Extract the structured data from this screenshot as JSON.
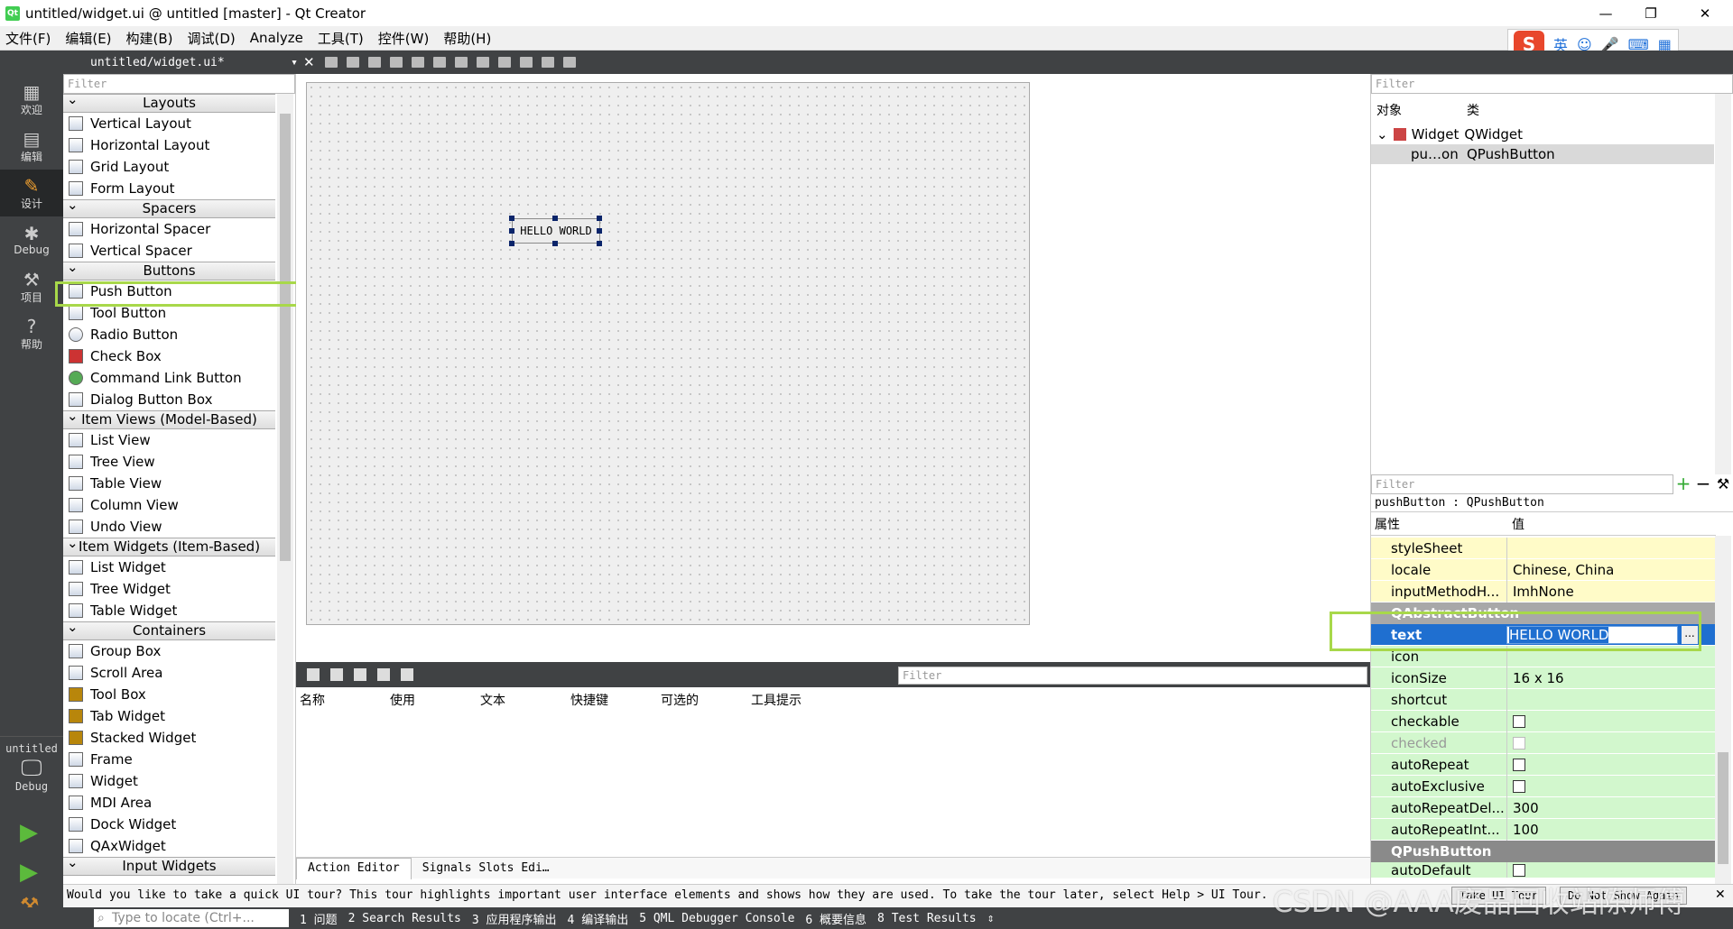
{
  "window": {
    "title": "untitled/widget.ui @ untitled [master] - Qt Creator",
    "app_icon": "Qt"
  },
  "menu": [
    "文件(F)",
    "编辑(E)",
    "构建(B)",
    "调试(D)",
    "Analyze",
    "工具(T)",
    "控件(W)",
    "帮助(H)"
  ],
  "ime": {
    "logo": "S",
    "lang": "英"
  },
  "modes": [
    {
      "label": "欢迎",
      "icon": "grid-icon"
    },
    {
      "label": "编辑",
      "icon": "edit-icon"
    },
    {
      "label": "设计",
      "icon": "design-icon",
      "active": true
    },
    {
      "label": "Debug",
      "icon": "bug-icon"
    },
    {
      "label": "项目",
      "icon": "wrench-icon"
    },
    {
      "label": "帮助",
      "icon": "help-icon"
    }
  ],
  "kit": {
    "project": "untitled",
    "mode": "Debug"
  },
  "document": {
    "tab": "untitled/widget.ui*"
  },
  "widgetbox": {
    "filter": "Filter",
    "layouts_title": "Layouts",
    "layouts": [
      "Vertical Layout",
      "Horizontal Layout",
      "Grid Layout",
      "Form Layout"
    ],
    "spacers_title": "Spacers",
    "spacers": [
      "Horizontal Spacer",
      "Vertical Spacer"
    ],
    "buttons_title": "Buttons",
    "buttons": [
      "Push Button",
      "Tool Button",
      "Radio Button",
      "Check Box",
      "Command Link Button",
      "Dialog Button Box"
    ],
    "itemviews_title": "Item Views (Model-Based)",
    "itemviews": [
      "List View",
      "Tree View",
      "Table View",
      "Column View",
      "Undo View"
    ],
    "itemwidgets_title": "Item Widgets (Item-Based)",
    "itemwidgets": [
      "List Widget",
      "Tree Widget",
      "Table Widget"
    ],
    "containers_title": "Containers",
    "containers": [
      "Group Box",
      "Scroll Area",
      "Tool Box",
      "Tab Widget",
      "Stacked Widget",
      "Frame",
      "Widget",
      "MDI Area",
      "Dock Widget",
      "QAxWidget"
    ],
    "input_title": "Input Widgets"
  },
  "form": {
    "button_text": "HELLO WORLD"
  },
  "action_editor": {
    "filter": "Filter",
    "columns": [
      "名称",
      "使用",
      "文本",
      "快捷键",
      "可选的",
      "工具提示"
    ],
    "tabs": [
      "Action Editor",
      "Signals Slots Edi…"
    ]
  },
  "object_inspector": {
    "filter": "Filter",
    "col_object": "对象",
    "col_class": "类",
    "rows": [
      {
        "object": "Widget",
        "class": "QWidget"
      },
      {
        "object": "pu…on",
        "class": "QPushButton"
      }
    ]
  },
  "property_editor": {
    "filter": "Filter",
    "header": "pushButton : QPushButton",
    "col_prop": "属性",
    "col_value": "值",
    "rows_top": [
      {
        "k": "styleSheet",
        "v": ""
      },
      {
        "k": "locale",
        "v": "Chinese, China"
      },
      {
        "k": "inputMethodH...",
        "v": "ImhNone"
      }
    ],
    "section_abstract": "QAbstractButton",
    "text_key": "text",
    "text_value": "HELLO WORLD",
    "text_more": "...",
    "rows_abstract": [
      {
        "k": "icon",
        "v": ""
      },
      {
        "k": "iconSize",
        "v": "16 x 16"
      },
      {
        "k": "shortcut",
        "v": ""
      }
    ],
    "checkable": "checkable",
    "checked": "checked",
    "autoRepeat": "autoRepeat",
    "autoExclusive": "autoExclusive",
    "rows_numbers": [
      {
        "k": "autoRepeatDel...",
        "v": "300"
      },
      {
        "k": "autoRepeatInt...",
        "v": "100"
      }
    ],
    "section_push": "QPushButton",
    "autoDefault": "autoDefault"
  },
  "status": {
    "message": "Would you like to take a quick UI tour? This tour highlights important user interface elements and shows how they are used. To take the tour later, select Help > UI Tour.",
    "take_tour": "Take UI Tour",
    "dont_show": "Do Not Show Again"
  },
  "bottom": {
    "locator": "Type to locate (Ctrl+...",
    "tabs": [
      "1 问题",
      "2 Search Results",
      "3 应用程序输出",
      "4 编译输出",
      "5 QML Debugger Console",
      "6 概要信息",
      "8 Test Results"
    ]
  },
  "watermark": "CSDN @AAA废品回收站陈师傅"
}
